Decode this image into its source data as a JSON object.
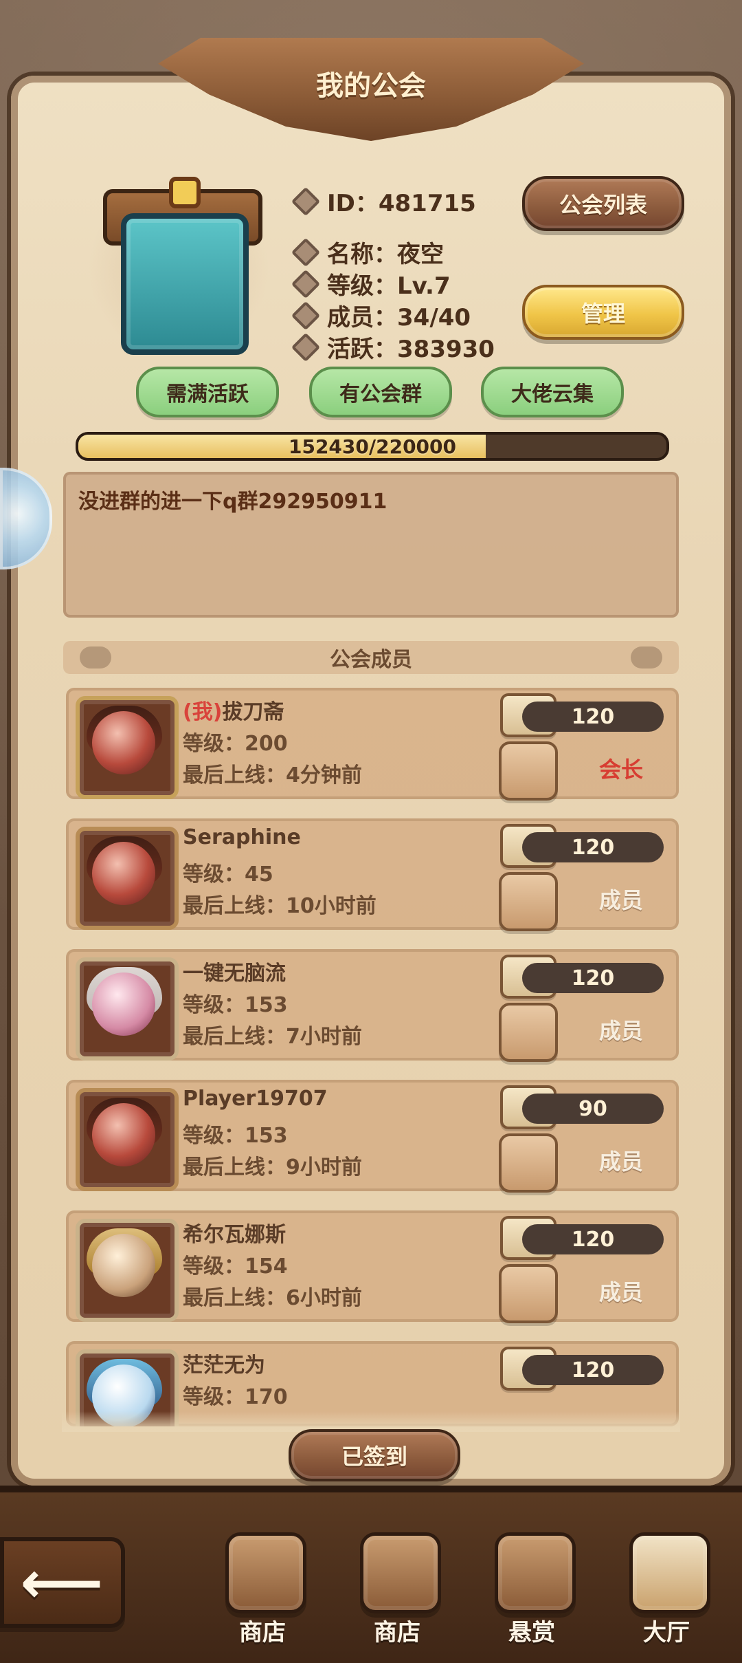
{
  "header": {
    "title": "我的公会"
  },
  "guild": {
    "id_line": "ID：481715",
    "name_line": "名称：夜空",
    "level_line": "等级：Lv.7",
    "members_line": "成员：34/40",
    "activity_line": "活跃：383930"
  },
  "buttons": {
    "guild_list": "公会列表",
    "manage": "管理",
    "signed": "已签到"
  },
  "tags": [
    "需满活跃",
    "有公会群",
    "大佬云集"
  ],
  "progress": {
    "text": "152430/220000",
    "current": 152430,
    "max": 220000
  },
  "notice": {
    "text": "没进群的进一下q群292950911"
  },
  "members_section": {
    "title": "公会成员"
  },
  "members": [
    {
      "prefix": "(我)",
      "name": "拔刀斋",
      "level": "等级：200",
      "last_online": "最后上线：4分钟前",
      "points": "120",
      "role": "会长"
    },
    {
      "prefix": "",
      "name": "Seraphine",
      "level": "等级：45",
      "last_online": "最后上线：10小时前",
      "points": "120",
      "role": "成员"
    },
    {
      "prefix": "",
      "name": "一键无脑流",
      "level": "等级：153",
      "last_online": "最后上线：7小时前",
      "points": "120",
      "role": "成员"
    },
    {
      "prefix": "",
      "name": "Player19707",
      "level": "等级：153",
      "last_online": "最后上线：9小时前",
      "points": "90",
      "role": "成员"
    },
    {
      "prefix": "",
      "name": "希尔瓦娜斯",
      "level": "等级：154",
      "last_online": "最后上线：6小时前",
      "points": "120",
      "role": "成员"
    },
    {
      "prefix": "",
      "name": "茫茫无为",
      "level": "等级：170",
      "last_online": "",
      "points": "120",
      "role": ""
    }
  ],
  "bottom_nav": {
    "items": [
      {
        "label": "商店",
        "icon": "warrior-helmet-icon"
      },
      {
        "label": "商店",
        "icon": "treasure-bag-icon"
      },
      {
        "label": "悬赏",
        "icon": "bounty-scroll-icon"
      },
      {
        "label": "大厅",
        "icon": "hall-banner-icon"
      }
    ]
  },
  "colors": {
    "accent_gold": "#f0c548",
    "accent_brown": "#8b5a3c",
    "leader_red": "#d73d32",
    "tag_green": "#8bcf7e"
  }
}
